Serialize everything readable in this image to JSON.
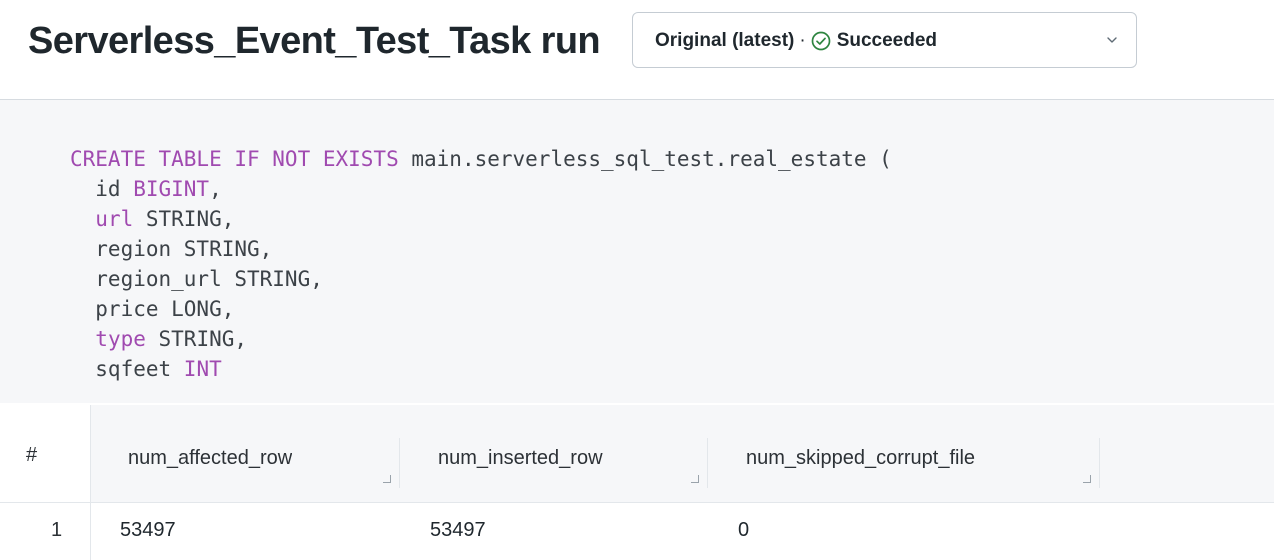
{
  "header": {
    "title": "Serverless_Event_Test_Task run",
    "run_selector": {
      "version_label": "Original (latest)",
      "separator": "·",
      "status_icon": "check-circle-icon",
      "status_label": "Succeeded",
      "chevron_icon": "chevron-down-icon",
      "status_color": "#2e8540"
    }
  },
  "code": {
    "lines": [
      [
        {
          "t": "CREATE TABLE IF NOT EXISTS",
          "kw": true
        },
        {
          "t": " main.serverless_sql_test.real_estate ("
        }
      ],
      [
        {
          "t": "  id "
        },
        {
          "t": "BIGINT",
          "kw": true
        },
        {
          "t": ","
        }
      ],
      [
        {
          "t": "  "
        },
        {
          "t": "url",
          "kw": true
        },
        {
          "t": " STRING,"
        }
      ],
      [
        {
          "t": "  region STRING,"
        }
      ],
      [
        {
          "t": "  region_url STRING,"
        }
      ],
      [
        {
          "t": "  price LONG,"
        }
      ],
      [
        {
          "t": "  "
        },
        {
          "t": "type",
          "kw": true
        },
        {
          "t": " STRING,"
        }
      ],
      [
        {
          "t": "  sqfeet "
        },
        {
          "t": "INT",
          "kw": true
        }
      ]
    ],
    "keyword_color": "#a04ab0"
  },
  "table": {
    "index_header": "#",
    "columns": [
      "num_affected_row",
      "num_inserted_row",
      "num_skipped_corrupt_file"
    ],
    "rows": [
      {
        "index": "1",
        "cells": [
          "53497",
          "53497",
          "0"
        ]
      }
    ]
  }
}
